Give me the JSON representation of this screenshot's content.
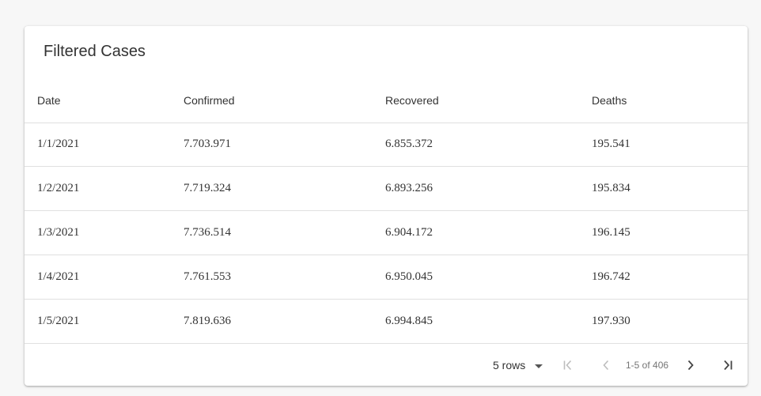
{
  "card": {
    "title": "Filtered Cases"
  },
  "table": {
    "columns": [
      "Date",
      "Confirmed",
      "Recovered",
      "Deaths"
    ],
    "rows": [
      [
        "1/1/2021",
        "7.703.971",
        "6.855.372",
        "195.541"
      ],
      [
        "1/2/2021",
        "7.719.324",
        "6.893.256",
        "195.834"
      ],
      [
        "1/3/2021",
        "7.736.514",
        "6.904.172",
        "196.145"
      ],
      [
        "1/4/2021",
        "7.761.553",
        "6.950.045",
        "196.742"
      ],
      [
        "1/5/2021",
        "7.819.636",
        "6.994.845",
        "197.930"
      ]
    ]
  },
  "pagination": {
    "rows_per_page": "5 rows",
    "page_info": "1-5 of 406",
    "icons": {
      "first": "first-page-icon",
      "prev": "chevron-left-icon",
      "next": "chevron-right-icon",
      "last": "last-page-icon",
      "dropdown": "caret-down-icon"
    }
  },
  "colors": {
    "text": "#333333",
    "muted": "#757575",
    "disabled_icon": "#bdbdbd",
    "active_icon": "#444444",
    "divider": "#e0e0e0",
    "background": "#f7f7f7",
    "card": "#ffffff"
  }
}
